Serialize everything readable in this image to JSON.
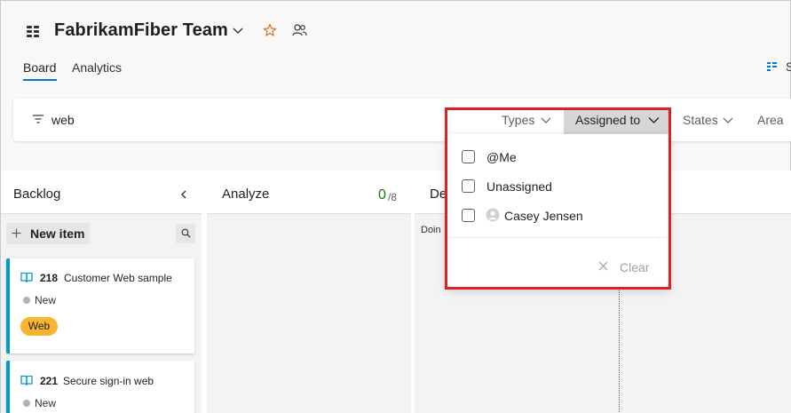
{
  "header": {
    "team_name": "FabrikamFiber Team",
    "tabs": [
      {
        "label": "Board"
      },
      {
        "label": "Analytics"
      }
    ],
    "settings_label_partial": "S"
  },
  "filter_bar": {
    "keyword": "web",
    "pills": {
      "types": "Types",
      "assigned_to": "Assigned to",
      "states": "States",
      "area": "Area"
    }
  },
  "assigned_dropdown": {
    "options": [
      {
        "label": "@Me",
        "checked": false
      },
      {
        "label": "Unassigned",
        "checked": false
      },
      {
        "label": "Casey Jensen",
        "checked": false
      }
    ],
    "clear_label": "Clear"
  },
  "board": {
    "columns": {
      "backlog": {
        "title": "Backlog"
      },
      "analyze": {
        "title": "Analyze",
        "count": "0",
        "limit": "/8"
      },
      "develop": {
        "title": "De",
        "sub_label": "Doin"
      }
    },
    "new_item_label": "New item",
    "cards": [
      {
        "id": "218",
        "title": "Customer Web sample",
        "state": "New",
        "tag": "Web"
      },
      {
        "id": "221",
        "title": "Secure sign-in web",
        "state": "New"
      }
    ]
  },
  "colors": {
    "accent": "#0078d4",
    "card_border": "#009ccc",
    "tag_web": "#f7b531",
    "highlight_frame": "#e01f26",
    "count_green": "#107c10"
  }
}
